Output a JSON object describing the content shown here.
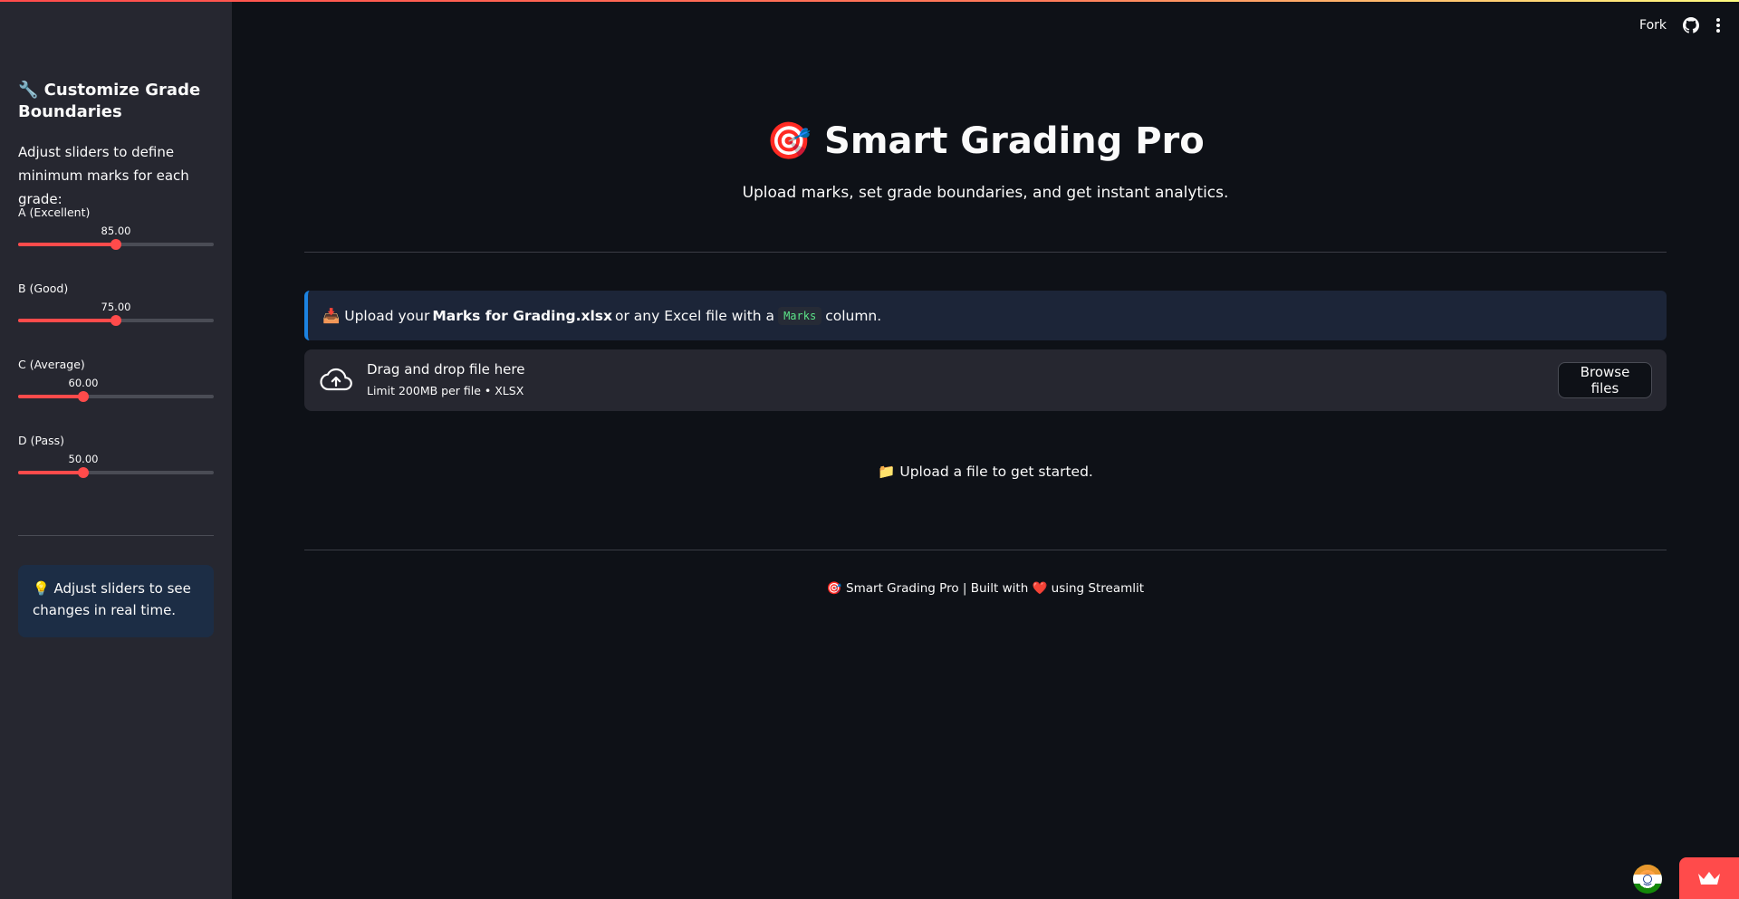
{
  "sidebar": {
    "title": "🔧 Customize Grade Boundaries",
    "description": "Adjust sliders to define minimum marks for each grade:",
    "sliders": [
      {
        "label": "A (Excellent)",
        "value": "85.00",
        "fraction": 0.5
      },
      {
        "label": "B (Good)",
        "value": "75.00",
        "fraction": 0.5
      },
      {
        "label": "C (Average)",
        "value": "60.00",
        "fraction": 0.333
      },
      {
        "label": "D (Pass)",
        "value": "50.00",
        "fraction": 0.333
      }
    ],
    "tip": "💡 Adjust sliders to see changes in real time."
  },
  "header": {
    "fork_label": "Fork",
    "github_icon": "github-icon",
    "menu_icon": "kebab-menu-icon"
  },
  "main": {
    "title": "🎯 Smart Grading Pro",
    "subtitle": "Upload marks, set grade boundaries, and get instant analytics.",
    "info": {
      "prefix": "📥 Upload your",
      "bold": "Marks for Grading.xlsx",
      "middle": "or any Excel file with a",
      "code": "Marks",
      "suffix": "column."
    },
    "uploader": {
      "icon": "cloud-upload-icon",
      "main_text": "Drag and drop file here",
      "sub_text": "Limit 200MB per file • XLSX",
      "browse_label": "Browse files"
    },
    "status": "📁 Upload a file to get started.",
    "footer": "🎯 Smart Grading Pro | Built with ❤️ using Streamlit"
  },
  "colors": {
    "accent": "#ff4b4b",
    "background": "#0e1117",
    "sidebar": "#262730",
    "info_border": "#1c83e1"
  }
}
